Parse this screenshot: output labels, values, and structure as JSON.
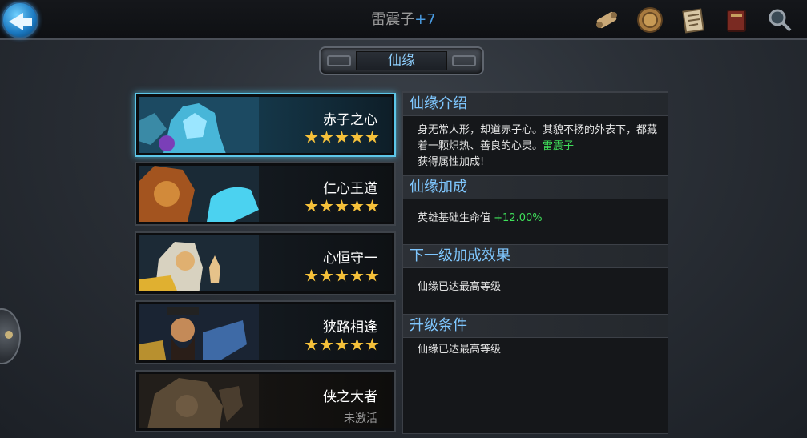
{
  "header": {
    "hero_name": "雷震子",
    "hero_plus": "+7",
    "icons": [
      "scroll-icon",
      "coin-icon",
      "letter-icon",
      "book-icon",
      "magnifier-icon"
    ]
  },
  "panel_title": "仙缘",
  "cards": [
    {
      "name": "赤子之心",
      "stars": 5,
      "selected": true
    },
    {
      "name": "仁心王道",
      "stars": 5,
      "selected": false
    },
    {
      "name": "心恒守一",
      "stars": 5,
      "selected": false
    },
    {
      "name": "狭路相逢",
      "stars": 5,
      "selected": false
    },
    {
      "name": "侠之大者",
      "stars": 0,
      "status": "未激活"
    }
  ],
  "info": {
    "intro_title": "仙缘介绍",
    "intro_text_before": "身无常人形，却道赤子心。其貌不扬的外表下，都藏着一颗炽热、善良的心灵。",
    "intro_hero": "雷震子",
    "intro_text_after": "获得属性加成!",
    "bonus_title": "仙缘加成",
    "bonus_label": "英雄基础生命值",
    "bonus_value": "+12.00%",
    "next_title": "下一级加成效果",
    "next_text": "仙缘已达最高等级",
    "upgrade_title": "升级条件",
    "upgrade_text": "仙缘已达最高等级"
  },
  "colors": {
    "accent_blue": "#7fc7ff",
    "selected_border": "#5cc6e8",
    "star": "#f6c13a",
    "green_value": "#3fe05a"
  }
}
